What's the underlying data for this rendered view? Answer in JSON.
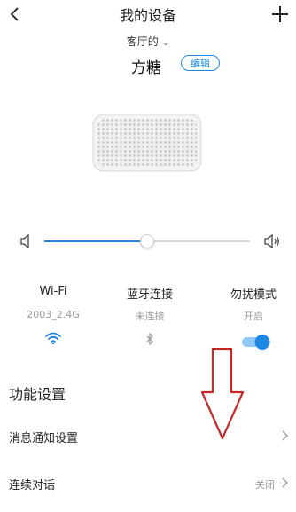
{
  "header": {
    "title": "我的设备",
    "back_icon": "chevron-left-icon",
    "add_icon": "plus-icon"
  },
  "device": {
    "room": "客厅的",
    "name": "方糖",
    "edit_label": "编辑"
  },
  "volume": {
    "level_fraction": 0.5
  },
  "status": {
    "wifi": {
      "label": "Wi-Fi",
      "value": "2003_2.4G"
    },
    "bluetooth": {
      "label": "蓝牙连接",
      "value": "未连接"
    },
    "dnd": {
      "label": "勿扰模式",
      "value": "开启",
      "enabled": true
    }
  },
  "settings": {
    "section_title": "功能设置",
    "items": [
      {
        "label": "消息通知设置",
        "value": ""
      },
      {
        "label": "连续对话",
        "value": "关闭"
      }
    ]
  },
  "colors": {
    "accent": "#1e88e5",
    "annotation_arrow": "#c62828"
  }
}
